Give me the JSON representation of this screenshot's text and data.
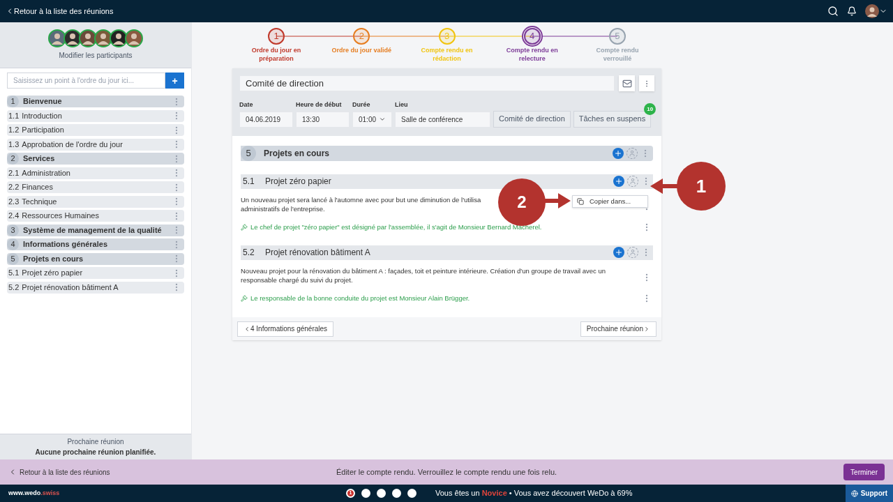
{
  "topbar": {
    "back": "Retour à la liste des réunions"
  },
  "sidebar": {
    "participants_link": "Modifier les participants",
    "agenda_input": {
      "placeholder": "Saisissez un point à l'ordre du jour ici...",
      "button": "+"
    },
    "items": [
      {
        "num": "1",
        "label": "Bienvenue",
        "kind": "section"
      },
      {
        "num": "1.1",
        "label": "Introduction",
        "kind": "item"
      },
      {
        "num": "1.2",
        "label": "Participation",
        "kind": "item"
      },
      {
        "num": "1.3",
        "label": "Approbation de l'ordre du jour",
        "kind": "item"
      },
      {
        "num": "2",
        "label": "Services",
        "kind": "section"
      },
      {
        "num": "2.1",
        "label": "Administration",
        "kind": "item"
      },
      {
        "num": "2.2",
        "label": "Finances",
        "kind": "item"
      },
      {
        "num": "2.3",
        "label": "Technique",
        "kind": "item"
      },
      {
        "num": "2.4",
        "label": "Ressources Humaines",
        "kind": "item"
      },
      {
        "num": "3",
        "label": "Système de management de la qualité",
        "kind": "section"
      },
      {
        "num": "4",
        "label": "Informations générales",
        "kind": "section"
      },
      {
        "num": "5",
        "label": "Projets en cours",
        "kind": "section"
      },
      {
        "num": "5.1",
        "label": "Projet zéro papier",
        "kind": "item"
      },
      {
        "num": "5.2",
        "label": "Projet rénovation bâtiment A",
        "kind": "item"
      }
    ],
    "next_meeting": {
      "title": "Prochaine réunion",
      "value": "Aucune prochaine réunion planifiée."
    }
  },
  "steps": [
    {
      "num": "1",
      "label": "Ordre du jour en préparation",
      "color": "#c0392b",
      "selected": false
    },
    {
      "num": "2",
      "label": "Ordre du jour validé",
      "color": "#e67e22",
      "selected": false
    },
    {
      "num": "3",
      "label": "Compte rendu en rédaction",
      "color": "#f1c40f",
      "selected": false
    },
    {
      "num": "4",
      "label": "Compte rendu en relecture",
      "color": "#7d3c98",
      "selected": true
    },
    {
      "num": "5",
      "label": "Compte rendu verrouillé",
      "color": "#98a4b0",
      "selected": false
    }
  ],
  "meeting": {
    "title": "Comité de direction",
    "fields": [
      {
        "label": "Date",
        "value": "04.06.2019",
        "kind": "text"
      },
      {
        "label": "Heure de début",
        "value": "13:30",
        "kind": "text"
      },
      {
        "label": "Durée",
        "value": "01:00",
        "kind": "select"
      },
      {
        "label": "Lieu",
        "value": "Salle de conférence",
        "kind": "text"
      }
    ],
    "buttons": [
      {
        "label": "Comité de direction"
      },
      {
        "label": "Tâches en suspens",
        "badge": "10"
      }
    ]
  },
  "section": {
    "num": "5",
    "title": "Projets en cours"
  },
  "topics": [
    {
      "num": "5.1",
      "title": "Projet zéro papier",
      "lines": [
        "Un nouveau projet sera lancé à l'automne avec pour but une diminution de l'utilisa",
        "administratifs de l'entreprise."
      ],
      "decision": "Le chef de projet \"zéro papier\" est désigné par l'assemblée, il s'agit de Monsieur Bernard Macherel."
    },
    {
      "num": "5.2",
      "title": "Projet rénovation bâtiment A",
      "lines": [
        "Nouveau projet pour la rénovation du bâtiment A : façades, toit et peinture intérieure. Création d'un groupe de travail avec un",
        "responsable chargé du suivi du projet."
      ],
      "decision": "Le responsable de la bonne conduite du projet est Monsieur Alain Brügger."
    }
  ],
  "context_menu": {
    "items": [
      "Copier dans..."
    ]
  },
  "callouts": [
    "1",
    "2"
  ],
  "nav": {
    "prev": "4 Informations générales",
    "next": "Prochaine réunion"
  },
  "action_bar": {
    "back": "Retour à la liste des réunions",
    "message": "Éditer le compte rendu. Verrouillez le compte rendu une fois relu.",
    "button": "Terminer"
  },
  "footer": {
    "brand": "www.wedo",
    "brand_suffix": ".swiss",
    "levels": [
      {
        "label": "1",
        "selected": true
      },
      {
        "selected": false
      },
      {
        "selected": false
      },
      {
        "selected": false
      },
      {
        "selected": false
      }
    ],
    "progress_prefix": "Vous êtes un",
    "rank": "Novice",
    "progress_suffix": "• Vous avez découvert WeDo à 69%",
    "support": "Support"
  }
}
